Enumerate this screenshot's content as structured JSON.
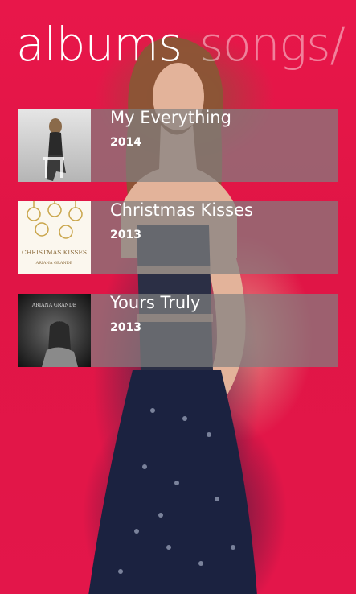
{
  "header": {
    "active_pivot": "albums",
    "next_pivot": "songs/"
  },
  "albums": [
    {
      "title": "My Everything",
      "year": "2014"
    },
    {
      "title": "Christmas Kisses",
      "year": "2013",
      "cover_text": "CHRISTMAS KISSES",
      "cover_subtext": "ARIANA GRANDE"
    },
    {
      "title": "Yours Truly",
      "year": "2013",
      "cover_text": "ARIANA GRANDE"
    }
  ],
  "colors": {
    "background": "#e8174a",
    "tile_overlay": "#808080",
    "text": "#ffffff"
  }
}
